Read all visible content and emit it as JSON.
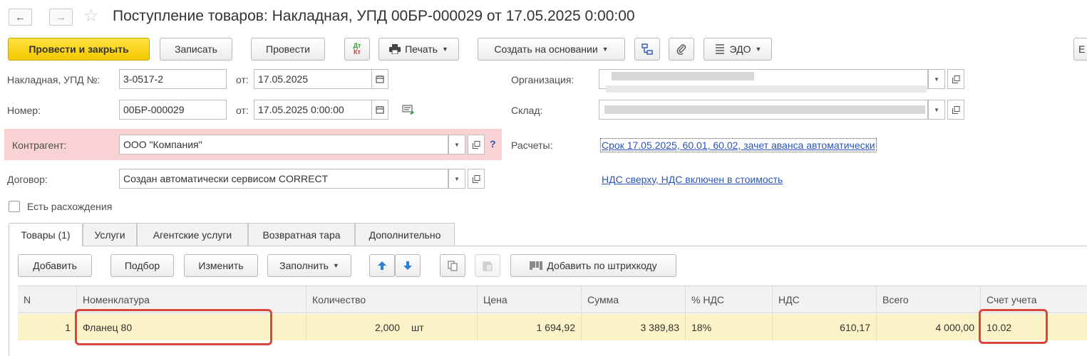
{
  "header": {
    "title": "Поступление товаров: Накладная, УПД 00БР-000029 от 17.05.2025 0:00:00"
  },
  "toolbar": {
    "post_close": "Провести и закрыть",
    "save": "Записать",
    "post": "Провести",
    "dt_kt_top": "Дт",
    "dt_kt_bottom": "Кт",
    "print": "Печать",
    "create_based": "Создать на основании",
    "edo": "ЭДО",
    "more": "Е"
  },
  "form": {
    "invoice_label": "Накладная, УПД №:",
    "invoice_value": "3-0517-2",
    "from_label": "от:",
    "invoice_date": "17.05.2025",
    "number_label": "Номер:",
    "number_value": "00БР-000029",
    "number_date": "17.05.2025  0:00:00",
    "org_label": "Организация:",
    "warehouse_label": "Склад:",
    "counterparty_label": "Контрагент:",
    "counterparty_value": "ООО \"Компания\"",
    "help": "?",
    "settlements_label": "Расчеты:",
    "settlements_link": "Срок 17.05.2025, 60.01, 60.02, зачет аванса автоматически",
    "contract_label": "Договор:",
    "contract_value": "Создан автоматически сервисом CORRECT",
    "vat_link": "НДС сверху, НДС включен в стоимость",
    "discrepancy_label": "Есть расхождения"
  },
  "tabs": [
    {
      "label": "Товары (1)"
    },
    {
      "label": "Услуги"
    },
    {
      "label": "Агентские услуги"
    },
    {
      "label": "Возвратная тара"
    },
    {
      "label": "Дополнительно"
    }
  ],
  "goods_toolbar": {
    "add": "Добавить",
    "pick": "Подбор",
    "change": "Изменить",
    "fill": "Заполнить",
    "barcode": "Добавить по штрихкоду"
  },
  "table": {
    "columns": [
      "N",
      "Номенклатура",
      "Количество",
      "Цена",
      "Сумма",
      "% НДС",
      "НДС",
      "Всего",
      "Счет учета"
    ],
    "rows": [
      {
        "n": "1",
        "item": "Фланец 80",
        "qty": "2,000",
        "unit": "шт",
        "price": "1 694,92",
        "sum": "3 389,83",
        "vat_rate": "18%",
        "vat": "610,17",
        "total": "4 000,00",
        "account": "10.02"
      }
    ]
  },
  "colors": {
    "primary_button": "#f5c800",
    "highlight": "#d9463a",
    "counterparty_bg": "#f9d3d3",
    "link": "#2a56b4",
    "selected_row": "#fbf2c8"
  }
}
